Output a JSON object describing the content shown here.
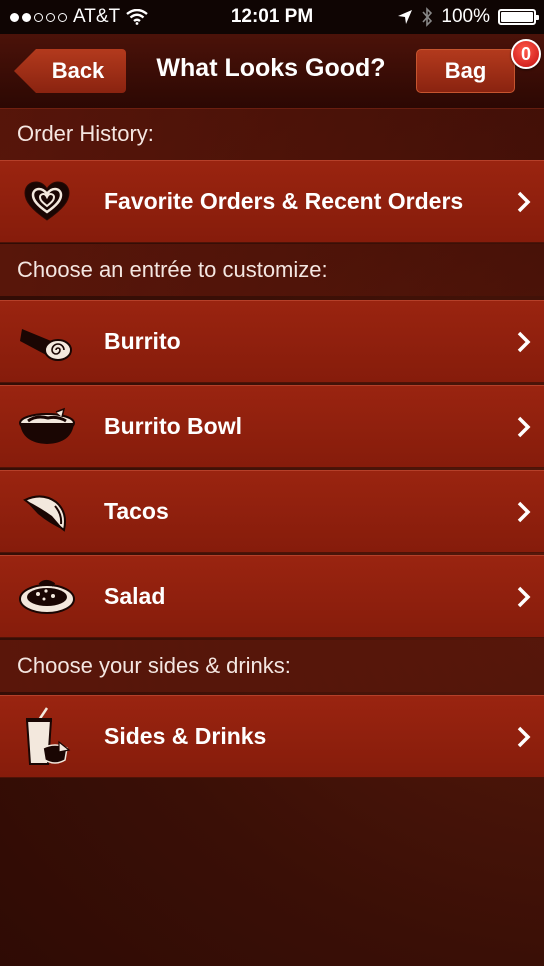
{
  "status_bar": {
    "carrier": "AT&T",
    "time": "12:01 PM",
    "battery": "100%",
    "battery_level": 1.0,
    "signal_bars_filled": 2,
    "signal_bars_total": 5
  },
  "navbar": {
    "back_label": "Back",
    "title": "What Looks Good?",
    "bag_label": "Bag",
    "bag_count": "0"
  },
  "sections": {
    "order_history": "Order History:",
    "entree": "Choose an entrée to customize:",
    "sides": "Choose your sides & drinks:"
  },
  "rows": {
    "favorites": {
      "label": "Favorite Orders & Recent Orders",
      "icon": "heart-icon"
    },
    "burrito": {
      "label": "Burrito",
      "icon": "burrito-icon"
    },
    "burrito_bowl": {
      "label": "Burrito Bowl",
      "icon": "burrito-bowl-icon"
    },
    "tacos": {
      "label": "Tacos",
      "icon": "taco-icon"
    },
    "salad": {
      "label": "Salad",
      "icon": "salad-icon"
    },
    "sides_drinks": {
      "label": "Sides & Drinks",
      "icon": "drink-cup-icon"
    }
  },
  "colors": {
    "row_red": "#9a2410",
    "header_dark": "#2c0803",
    "badge_red": "#c40f10"
  }
}
